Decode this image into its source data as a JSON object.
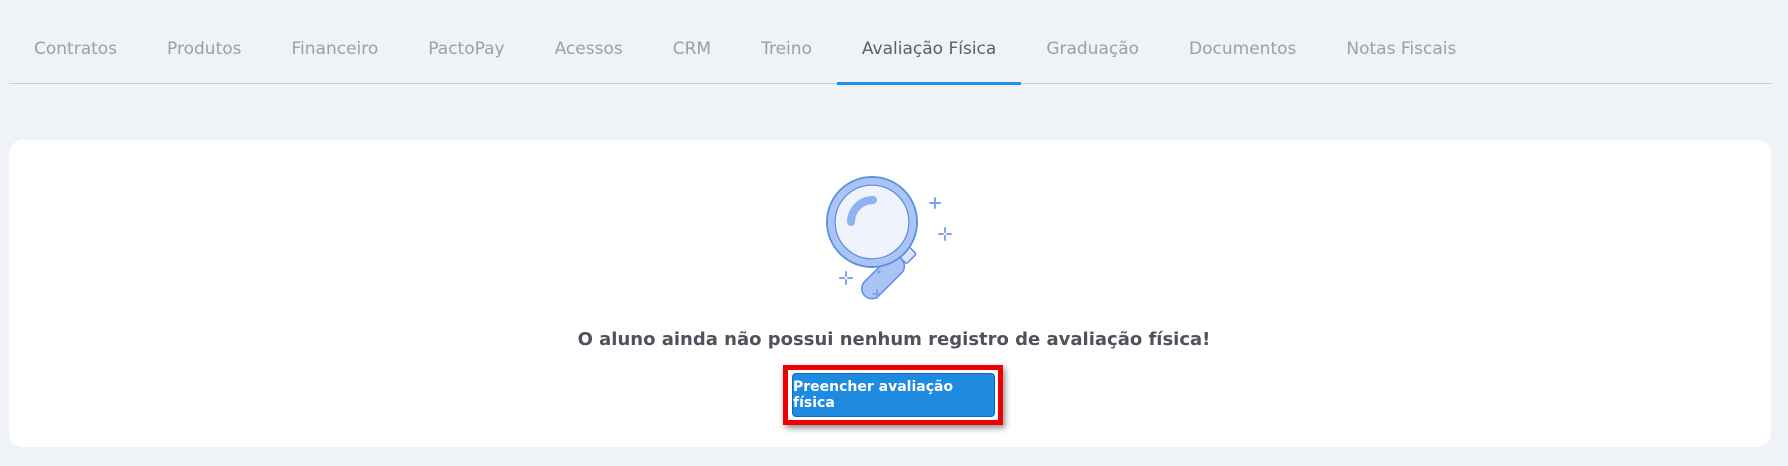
{
  "tabs": [
    {
      "label": "Contratos",
      "active": false
    },
    {
      "label": "Produtos",
      "active": false
    },
    {
      "label": "Financeiro",
      "active": false
    },
    {
      "label": "PactoPay",
      "active": false
    },
    {
      "label": "Acessos",
      "active": false
    },
    {
      "label": "CRM",
      "active": false
    },
    {
      "label": "Treino",
      "active": false
    },
    {
      "label": "Avaliação Física",
      "active": true
    },
    {
      "label": "Graduação",
      "active": false
    },
    {
      "label": "Documentos",
      "active": false
    },
    {
      "label": "Notas Fiscais",
      "active": false
    }
  ],
  "empty_state": {
    "icon": "magnifying-glass-icon",
    "message": "O aluno ainda não possui nenhum registro de avaliação física!",
    "button_label": "Preencher avaliação física"
  },
  "colors": {
    "accent": "#1e90e8",
    "button": "#1e8ae0",
    "highlight": "#ee0000",
    "background": "#eff2f7"
  }
}
